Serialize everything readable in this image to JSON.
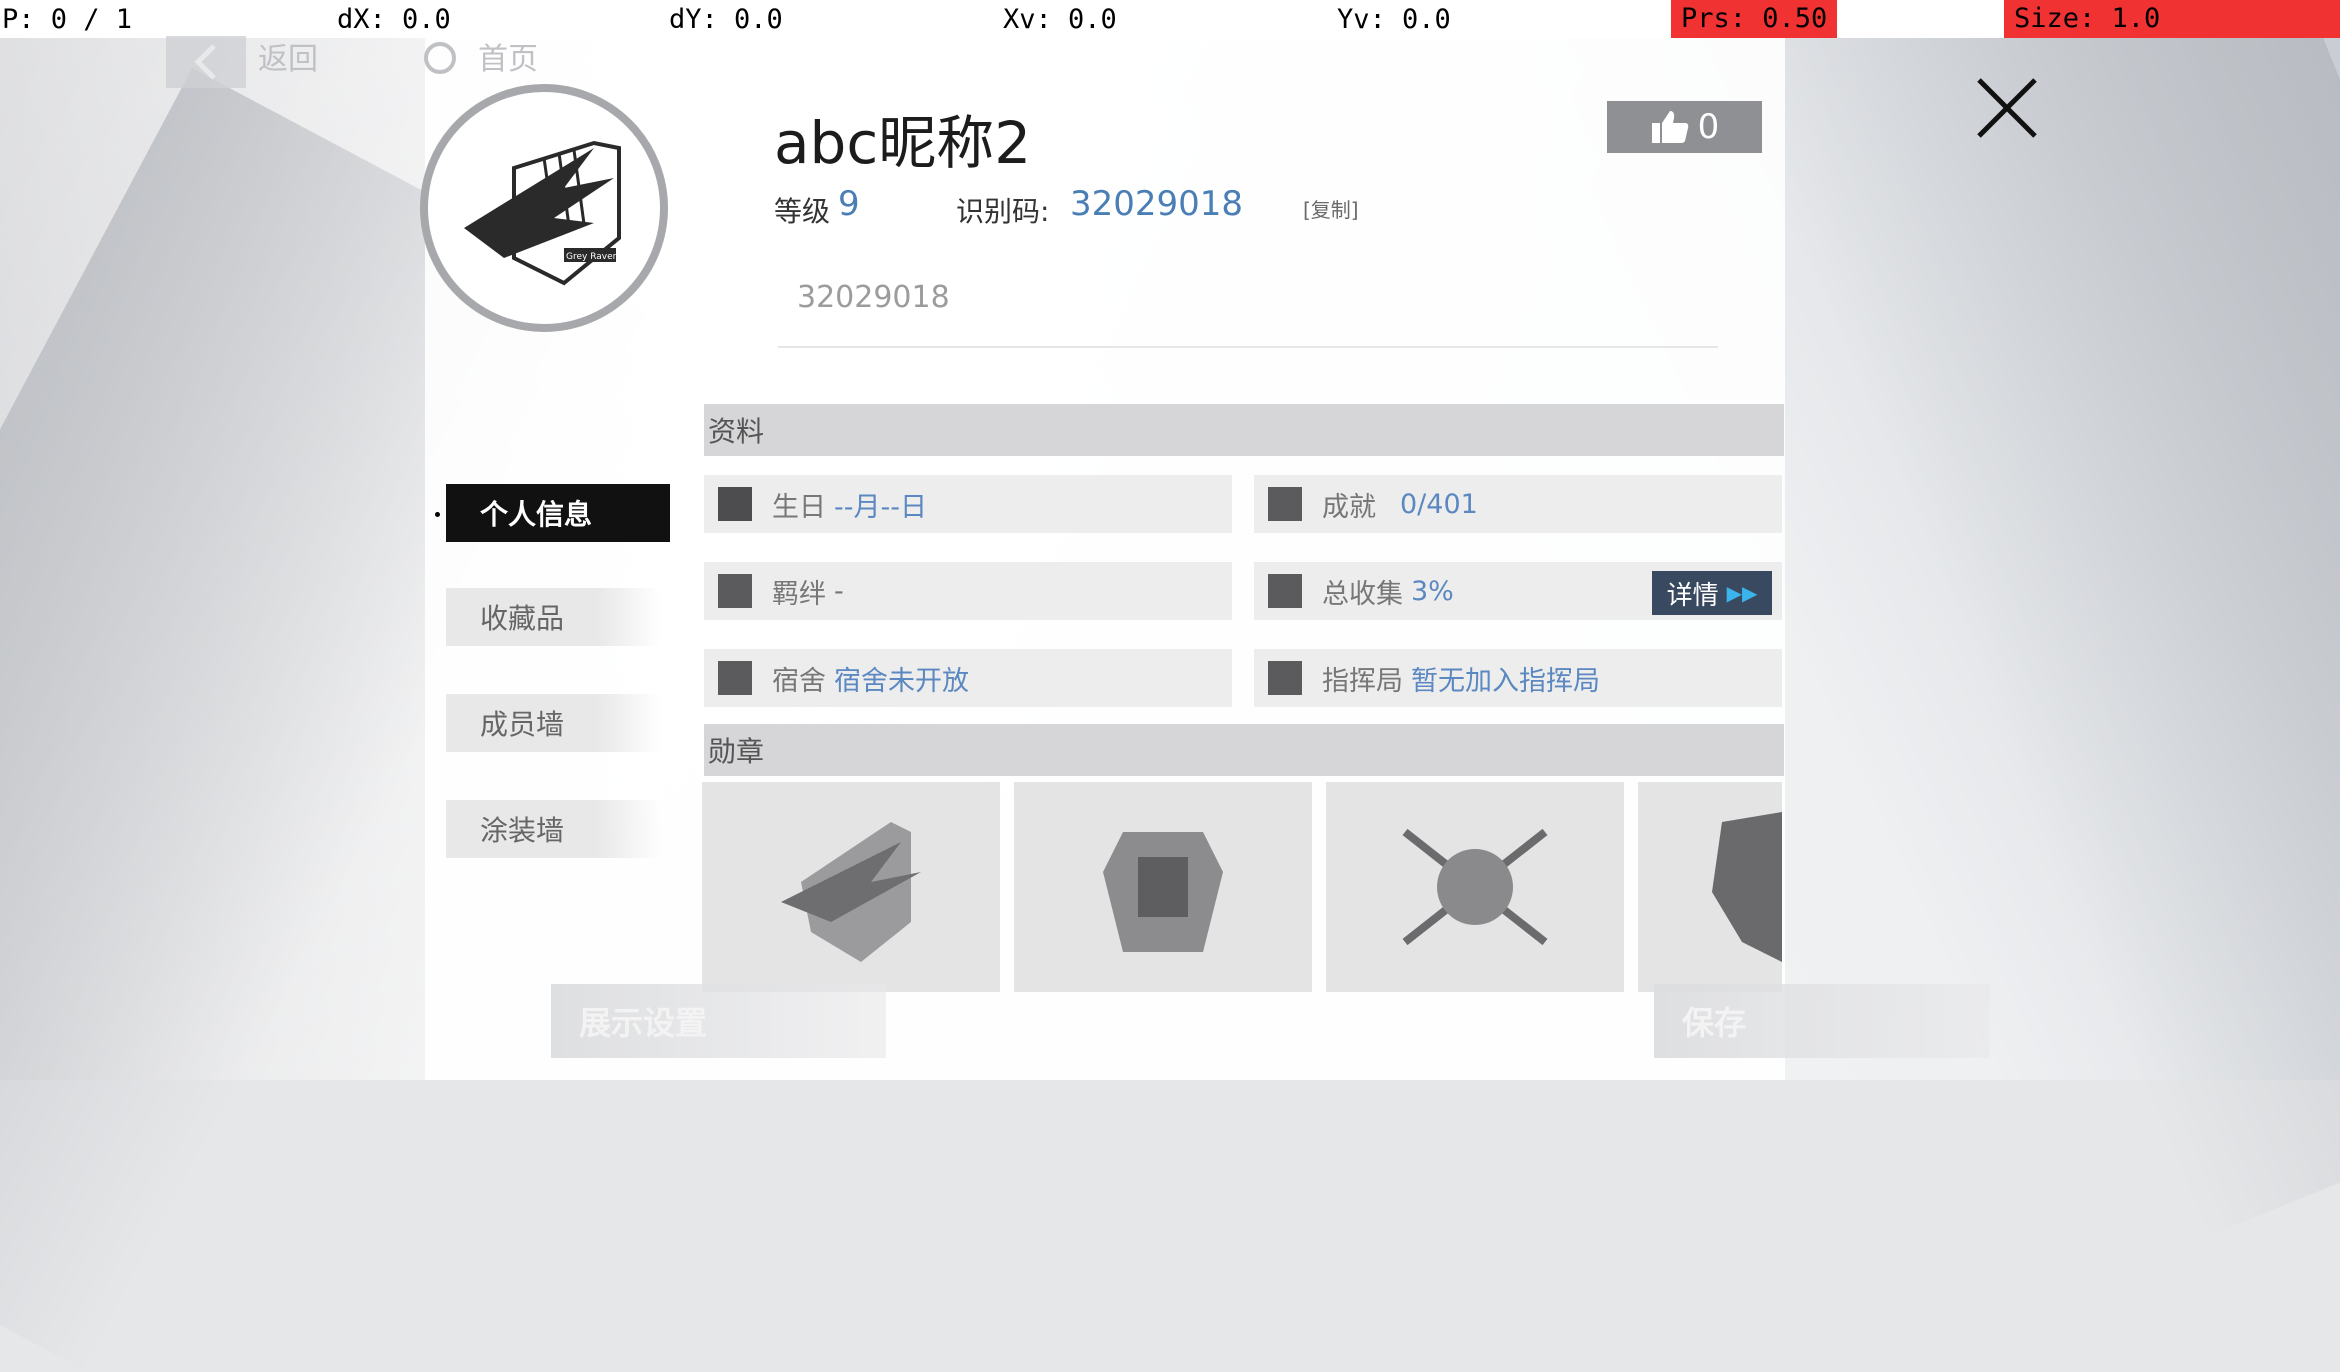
{
  "debug": {
    "p": "P: 0 / 1",
    "dx": "dX: 0.0",
    "dy": "dY: 0.0",
    "xv": "Xv: 0.0",
    "yv": "Yv: 0.0",
    "prs": "Prs: 0.50",
    "size": "Size: 1.0",
    "red_color": "#f03232"
  },
  "ghost": {
    "back_label": "返回",
    "home_label": "首页"
  },
  "profile": {
    "nickname": "abc昵称2",
    "likes": "0",
    "level_label": "等级",
    "level_value": "9",
    "id_label": "识别码:",
    "id_value": "32029018",
    "copy_label": "[复制]",
    "sub_id": "32029018",
    "accent_color": "#4a7fb5",
    "avatar_text": "Grey Ravens"
  },
  "tabs": {
    "active": "个人信息",
    "items": [
      "收藏品",
      "成员墙",
      "涂装墙"
    ]
  },
  "sections": {
    "info_title": "资料",
    "medals_title": "勋章"
  },
  "info": {
    "birthday_label": "生日",
    "birthday_value": "--月--日",
    "achievement_label": "成就",
    "achievement_value": "0/401",
    "bond_label": "羁绊",
    "bond_value": "-",
    "collection_label": "总收集",
    "collection_value": "3%",
    "details_label": "详情",
    "dorm_label": "宿舍",
    "dorm_value": "宿舍未开放",
    "hq_label": "指挥局",
    "hq_value": "暂无加入指挥局"
  },
  "buttons": {
    "display_settings": "展示设置",
    "save": "保存"
  },
  "icons": {
    "close": "close-icon",
    "like": "thumbs-up-icon"
  }
}
